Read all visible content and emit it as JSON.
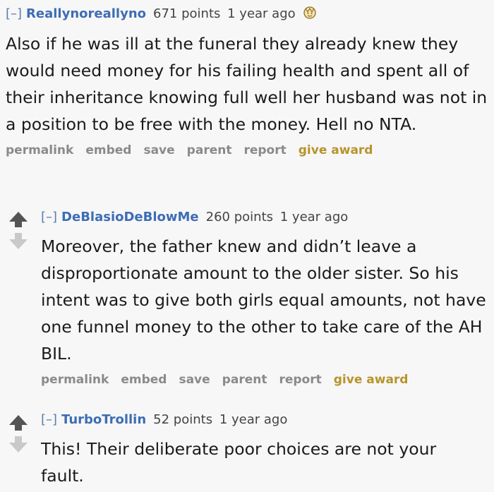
{
  "comments": [
    {
      "toggle": "[–]",
      "author": "Reallynoreallyno",
      "score": "671 points",
      "time": "1 year ago",
      "body": "Also if he was ill at the funeral they already knew they would need money for his failing health and spent all of their inheritance knowing full well her husband was not in a position to be free with the money. Hell no NTA.",
      "actions": [
        "permalink",
        "embed",
        "save",
        "parent",
        "report",
        "give award"
      ]
    },
    {
      "toggle": "[–]",
      "author": "DeBlasioDeBlowMe",
      "score": "260 points",
      "time": "1 year ago",
      "body": "Moreover, the father knew and didn’t leave a disproportionate amount to the older sister. So his intent was to give both girls equal amounts, not have one funnel money to the other to take care of the AH BIL.",
      "actions": [
        "permalink",
        "embed",
        "save",
        "parent",
        "report",
        "give award"
      ]
    },
    {
      "toggle": "[–]",
      "author": "TurboTrollin",
      "score": "52 points",
      "time": "1 year ago",
      "body": "This! Their deliberate poor choices are not your fault."
    }
  ],
  "icons": {
    "award": "award-icon",
    "upvote": "upvote-arrow-icon",
    "downvote": "downvote-arrow-icon"
  },
  "colors": {
    "author": "#3d6db3",
    "give_award": "#b7942a",
    "actions": "#8a8a8a"
  }
}
